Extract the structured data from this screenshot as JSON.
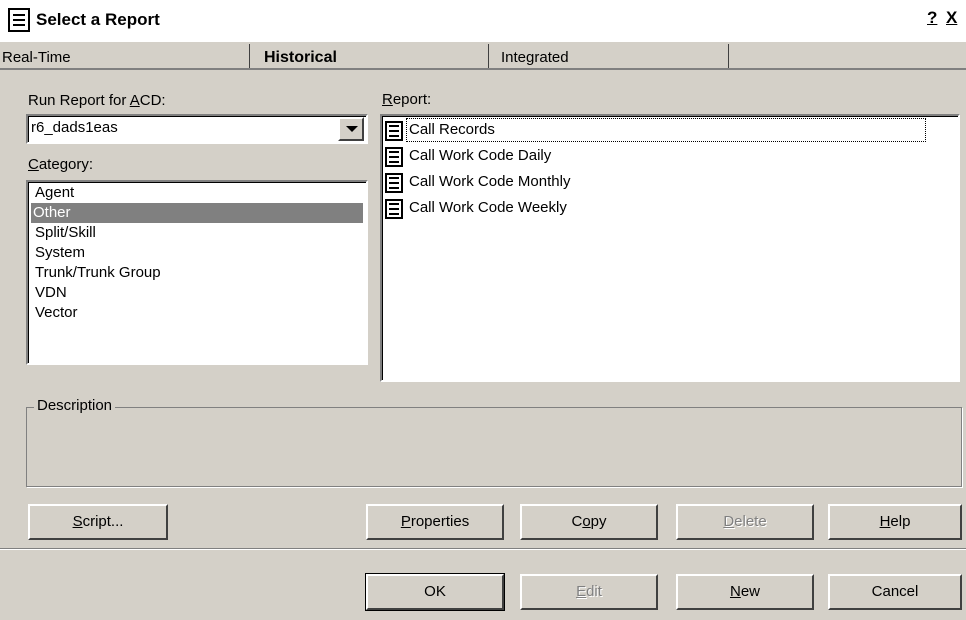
{
  "window": {
    "title": "Select a Report",
    "help_glyph": "?",
    "close_glyph": "X"
  },
  "tabs": [
    {
      "label": "Real-Time"
    },
    {
      "label": "Historical",
      "active": true
    },
    {
      "label": "Integrated"
    }
  ],
  "acd": {
    "label": "Run Report for ACD:",
    "mnemonic": "A",
    "value": "r6_dads1eas"
  },
  "category": {
    "label": "Category:",
    "items": [
      "Agent",
      "Other",
      "Split/Skill",
      "System",
      "Trunk/Trunk Group",
      "VDN",
      "Vector"
    ],
    "selected": "Other"
  },
  "report": {
    "label": "Report:",
    "items": [
      "Call Records",
      "Call Work Code Daily",
      "Call Work Code Monthly",
      "Call Work Code Weekly"
    ],
    "focused": "Call Records"
  },
  "description": {
    "label": "Description",
    "text": ""
  },
  "buttons_row1": {
    "script": "Script...",
    "properties": "Properties",
    "copy": "Copy",
    "delete": "Delete",
    "help": "Help"
  },
  "buttons_row2": {
    "ok": "OK",
    "edit": "Edit",
    "new": "New",
    "cancel": "Cancel"
  },
  "colors": {
    "face": "#d4d0c8",
    "selection": "#808080",
    "disabled_text": "#808080"
  }
}
